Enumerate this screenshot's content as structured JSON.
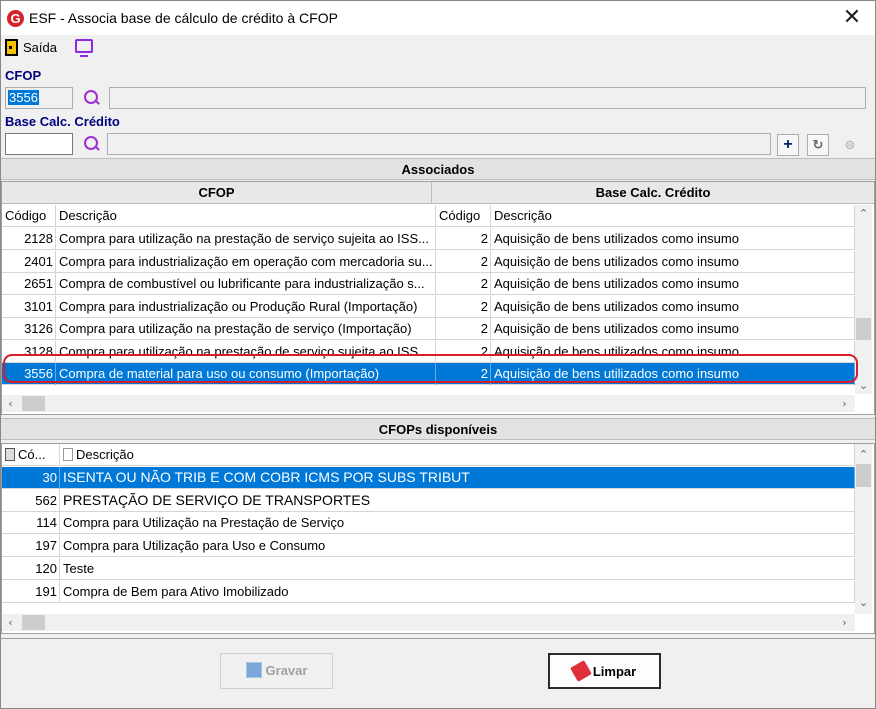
{
  "window": {
    "title": "ESF - Associa base de cálculo de crédito à CFOP",
    "logo_letter": "G",
    "close": "✕"
  },
  "toolbar": {
    "exit_label": "Saída"
  },
  "form": {
    "cfop_label": "CFOP",
    "cfop_value": "3556",
    "cfop_description": "",
    "base_label": "Base Calc. Crédito",
    "base_value": "",
    "base_description": "",
    "add_symbol": "+"
  },
  "associados": {
    "section_title": "Associados",
    "group_left": "CFOP",
    "group_right": "Base Calc. Crédito",
    "columns": [
      "Código",
      "Descrição",
      "Código",
      "Descrição"
    ],
    "rows": [
      [
        "2128",
        "Compra para utilização na prestação de serviço sujeita ao ISS...",
        "2",
        "Aquisição de bens utilizados como insumo"
      ],
      [
        "2401",
        "Compra para industrialização em operação com mercadoria su...",
        "2",
        "Aquisição de bens utilizados como insumo"
      ],
      [
        "2651",
        "Compra de combustível ou lubrificante para industrialização s...",
        "2",
        "Aquisição de bens utilizados como insumo"
      ],
      [
        "3101",
        "Compra para industrialização ou Produção Rural  (Importação)",
        "2",
        "Aquisição de bens utilizados como insumo"
      ],
      [
        "3126",
        "Compra para utilização na prestação de serviço  (Importação)",
        "2",
        "Aquisição de bens utilizados como insumo"
      ],
      [
        "3128",
        "Compra para utilização na prestação de serviço sujeita ao ISS...",
        "2",
        "Aquisição de bens utilizados como insumo"
      ],
      [
        "3556",
        "Compra de material para uso ou consumo (Importação)",
        "2",
        "Aquisição de bens utilizados como insumo"
      ]
    ],
    "selected_row": 6
  },
  "disponiveis": {
    "section_title": "CFOPs disponíveis",
    "columns": [
      "Có...",
      "Descrição"
    ],
    "rows": [
      [
        "30",
        "ISENTA OU NÃO TRIB E COM COBR ICMS POR SUBS TRIBUT"
      ],
      [
        "562",
        "PRESTAÇÃO DE SERVIÇO DE TRANSPORTES"
      ],
      [
        "114",
        "Compra para Utilização na Prestação de Serviço"
      ],
      [
        "197",
        "Compra para Utilização para Uso e Consumo"
      ],
      [
        "120",
        "Teste"
      ],
      [
        "191",
        "Compra de Bem para Ativo Imobilizado"
      ]
    ],
    "selected_row": 0
  },
  "buttons": {
    "save_label": "Gravar",
    "clear_label": "Limpar"
  },
  "colors": {
    "selection": "#0078d7",
    "label_blue": "#000080",
    "highlight_ring": "#d61f2b"
  }
}
